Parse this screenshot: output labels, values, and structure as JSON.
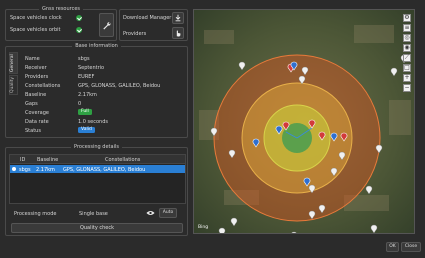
{
  "gnss_resources": {
    "title": "Gnss resources",
    "items": [
      {
        "label": "Space vehicles clock",
        "ok": true
      },
      {
        "label": "Space vehicles orbit",
        "ok": true
      }
    ]
  },
  "download": {
    "label": "Download Manager",
    "providers_label": "Providers"
  },
  "base_info": {
    "title": "Base information",
    "tabs": [
      "General",
      "Quality"
    ],
    "fields": [
      {
        "label": "Name",
        "value": "sbgs"
      },
      {
        "label": "Receiver",
        "value": "Septentrio"
      },
      {
        "label": "Providers",
        "value": "EUREF"
      },
      {
        "label": "Constellations",
        "value": "GPS, GLONASS, GALILEO, Beidou"
      },
      {
        "label": "Baseline",
        "value": "2.17km"
      },
      {
        "label": "Gaps",
        "value": "0"
      },
      {
        "label": "Coverage",
        "value": "Full"
      },
      {
        "label": "Data rate",
        "value": "1.0 seconds"
      },
      {
        "label": "Status",
        "value": "Valid"
      }
    ]
  },
  "processing": {
    "title": "Processing details",
    "columns": [
      "ID",
      "Baseline",
      "Constellations"
    ],
    "rows": [
      {
        "id": "sbgs",
        "baseline": "2.17km",
        "constellations": "GPS, GLONASS, GALILEO, Beidou"
      }
    ],
    "mode_label": "Processing mode",
    "mode_value": "Single base",
    "auto_label": "Auto",
    "quality_check_label": "Quality check"
  },
  "map": {
    "attribution": "Bing"
  },
  "footer": {
    "ok_label": "OK",
    "close_label": "Close"
  },
  "colors": {
    "valid": "#2a7fd4",
    "full": "#2ea043",
    "selection": "#2a7fd4"
  }
}
